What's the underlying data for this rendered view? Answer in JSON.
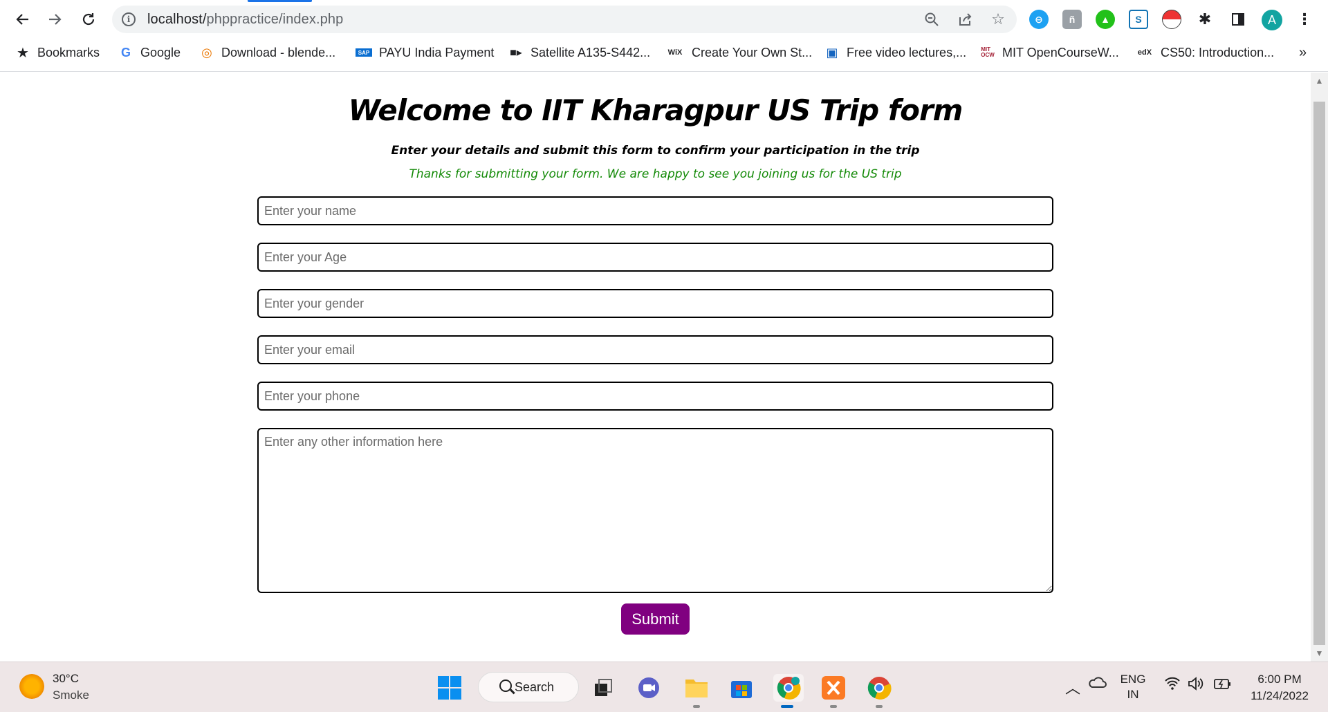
{
  "browser": {
    "url_host": "localhost/",
    "url_path": "phppractice/index.php",
    "back_icon": "arrow-left-icon",
    "forward_icon": "arrow-right-icon",
    "reload_icon": "reload-icon",
    "bookmarks": [
      {
        "label": "Bookmarks",
        "icon": "star-icon"
      },
      {
        "label": "Google",
        "icon": "google-icon"
      },
      {
        "label": "Download - blende...",
        "icon": "blender-icon"
      },
      {
        "label": "PAYU India Payment",
        "icon": "sap-icon"
      },
      {
        "label": "Satellite A135-S442...",
        "icon": "camera-icon"
      },
      {
        "label": "Create Your Own St...",
        "icon": "wix-icon"
      },
      {
        "label": "Free video lectures,...",
        "icon": "monitor-icon"
      },
      {
        "label": "MIT OpenCourseW...",
        "icon": "mit-ocw-icon"
      },
      {
        "label": "CS50: Introduction...",
        "icon": "edx-icon"
      }
    ],
    "more_bookmarks": "»",
    "avatar_letter": "A"
  },
  "page": {
    "title": "Welcome to IIT Kharagpur US Trip form",
    "subtitle": "Enter your details and submit this form to confirm your participation in the trip",
    "thanks": "Thanks for submitting your form. We are happy to see you joining us for the US trip",
    "fields": {
      "name": "Enter your name",
      "age": "Enter your Age",
      "gender": "Enter your gender",
      "email": "Enter your email",
      "phone": "Enter your phone",
      "info": "Enter any other information here"
    },
    "submit_label": "Submit"
  },
  "taskbar": {
    "temperature": "30°C",
    "weather": "Smoke",
    "search_label": "Search",
    "lang_top": "ENG",
    "lang_bottom": "IN",
    "time": "6:00 PM",
    "date": "11/24/2022"
  }
}
